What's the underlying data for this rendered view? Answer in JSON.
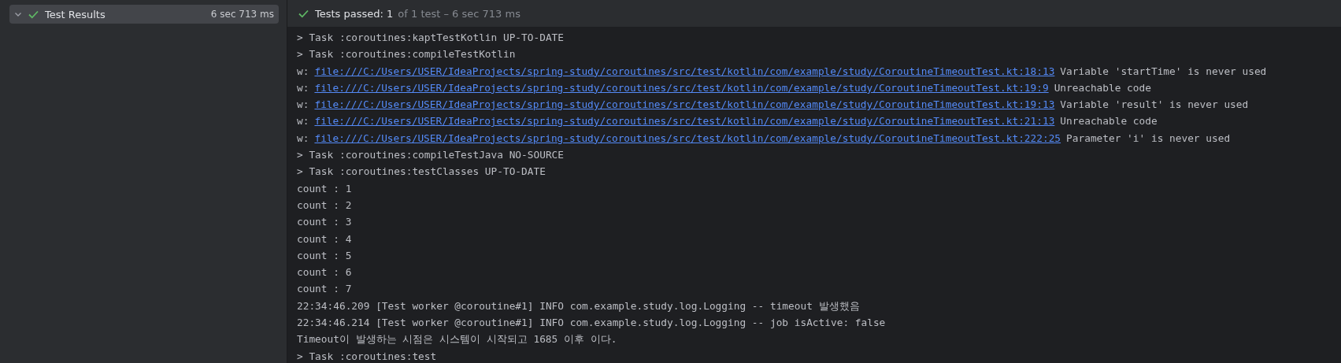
{
  "test_tree": {
    "items": [
      {
        "label": "Test Results",
        "duration": "6 sec 713 ms",
        "expanded": true,
        "passed": true,
        "selected": true
      }
    ]
  },
  "status": {
    "passed": true,
    "summary": "Tests passed: 1",
    "detail": "of 1 test – 6 sec 713 ms"
  },
  "console": {
    "lines": [
      {
        "kind": "task",
        "text": "> Task :coroutines:kaptTestKotlin UP-TO-DATE"
      },
      {
        "kind": "task",
        "text": "> Task :coroutines:compileTestKotlin"
      },
      {
        "kind": "warning",
        "prefix": "w:",
        "link": "file:///C:/Users/USER/IdeaProjects/spring-study/coroutines/src/test/kotlin/com/example/study/CoroutineTimeoutTest.kt:18:13",
        "message": "Variable 'startTime' is never used"
      },
      {
        "kind": "warning",
        "prefix": "w:",
        "link": "file:///C:/Users/USER/IdeaProjects/spring-study/coroutines/src/test/kotlin/com/example/study/CoroutineTimeoutTest.kt:19:9",
        "message": "Unreachable code"
      },
      {
        "kind": "warning",
        "prefix": "w:",
        "link": "file:///C:/Users/USER/IdeaProjects/spring-study/coroutines/src/test/kotlin/com/example/study/CoroutineTimeoutTest.kt:19:13",
        "message": "Variable 'result' is never used"
      },
      {
        "kind": "warning",
        "prefix": "w:",
        "link": "file:///C:/Users/USER/IdeaProjects/spring-study/coroutines/src/test/kotlin/com/example/study/CoroutineTimeoutTest.kt:21:13",
        "message": "Unreachable code"
      },
      {
        "kind": "warning",
        "prefix": "w:",
        "link": "file:///C:/Users/USER/IdeaProjects/spring-study/coroutines/src/test/kotlin/com/example/study/CoroutineTimeoutTest.kt:222:25",
        "message": "Parameter 'i' is never used"
      },
      {
        "kind": "task",
        "text": "> Task :coroutines:compileTestJava NO-SOURCE"
      },
      {
        "kind": "task",
        "text": "> Task :coroutines:testClasses UP-TO-DATE"
      },
      {
        "kind": "output",
        "text": "count : 1"
      },
      {
        "kind": "output",
        "text": "count : 2"
      },
      {
        "kind": "output",
        "text": "count : 3"
      },
      {
        "kind": "output",
        "text": "count : 4"
      },
      {
        "kind": "output",
        "text": "count : 5"
      },
      {
        "kind": "output",
        "text": "count : 6"
      },
      {
        "kind": "output",
        "text": "count : 7"
      },
      {
        "kind": "output",
        "text": "22:34:46.209 [Test worker @coroutine#1] INFO com.example.study.log.Logging -- timeout 발생했음"
      },
      {
        "kind": "output",
        "text": "22:34:46.214 [Test worker @coroutine#1] INFO com.example.study.log.Logging -- job isActive: false"
      },
      {
        "kind": "output",
        "text": "Timeout이 발생하는 시점은 시스템이 시작되고 1685 이후 이다."
      },
      {
        "kind": "task",
        "text": "> Task :coroutines:test"
      }
    ]
  }
}
